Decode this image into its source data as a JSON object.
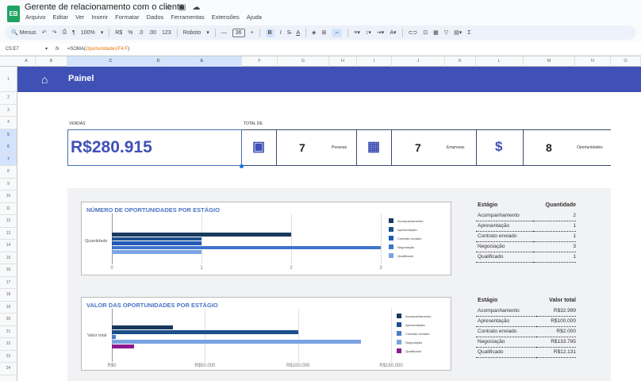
{
  "app": {
    "title": "Gerente de relacionamento com o cliente",
    "logo": "EB",
    "menu": [
      "Arquivo",
      "Editar",
      "Ver",
      "Inserir",
      "Formatar",
      "Dados",
      "Ferramentas",
      "Extensões",
      "Ajuda"
    ]
  },
  "toolbar": {
    "search": "Menus",
    "zoom": "100%",
    "currency": "R$",
    "percent": "%",
    "dec_less": ".0",
    "dec_more": ".00",
    "format": "123",
    "font": "Roboto",
    "font_size": "36",
    "bold": "B",
    "italic": "I",
    "sigma": "Σ"
  },
  "formula": {
    "cell_ref": "C5:E7",
    "fx": "fx",
    "formula_prefix": "=SOMA(",
    "formula_ref": "Oportunidades!F4:F",
    "formula_suffix": ")"
  },
  "columns": [
    "A",
    "B",
    "C",
    "D",
    "E",
    "F",
    "G",
    "H",
    "I",
    "J",
    "K",
    "L",
    "M",
    "N",
    "O"
  ],
  "rows": [
    "1",
    "2",
    "3",
    "4",
    "5",
    "6",
    "7",
    "8",
    "9",
    "10",
    "11",
    "12",
    "13",
    "14",
    "15",
    "16",
    "17",
    "18",
    "19",
    "20",
    "21",
    "22",
    "23",
    "24"
  ],
  "header": {
    "title": "Painel"
  },
  "kpi": {
    "sales_label": "VENDAS",
    "total_label": "TOTAL DE",
    "sales_value": "R$280.915",
    "items": [
      {
        "value": "7",
        "label": "Pessoas",
        "icon": "contact-icon"
      },
      {
        "value": "7",
        "label": "Empresas",
        "icon": "building-icon"
      },
      {
        "value": "8",
        "label": "Oportunidades",
        "icon": "dollar-icon"
      }
    ]
  },
  "chart_data": [
    {
      "type": "bar",
      "title": "NÚMERO DE OPORTUNIDADES POR ESTÁGIO",
      "ylabel": "Quantidade",
      "xlim": [
        0,
        3
      ],
      "xticks": [
        "0",
        "1",
        "2",
        "3"
      ],
      "series": [
        {
          "name": "Acompanhamento",
          "value": 2,
          "color": "#1a3a5e"
        },
        {
          "name": "Apresentação",
          "value": 1,
          "color": "#1d4f8e"
        },
        {
          "name": "Contrato enviado",
          "value": 1,
          "color": "#2459b8"
        },
        {
          "name": "Negociação",
          "value": 3,
          "color": "#3d74cc"
        },
        {
          "name": "Qualificado",
          "value": 1,
          "color": "#7ca4e2"
        }
      ]
    },
    {
      "type": "bar",
      "title": "VALOR DAS OPORTUNIDADES POR ESTÁGIO",
      "ylabel": "Valor total",
      "xlim": [
        0,
        150000
      ],
      "xticks": [
        "R$0",
        "R$50.000",
        "R$100.000",
        "R$150.000"
      ],
      "series": [
        {
          "name": "Acompanhamento",
          "value": 32999,
          "color": "#17375e"
        },
        {
          "name": "Apresentação",
          "value": 100000,
          "color": "#1c4f8a"
        },
        {
          "name": "Contrato enviado",
          "value": 2000,
          "color": "#4a7cc9"
        },
        {
          "name": "Negociação",
          "value": 133785,
          "color": "#7aa2e0"
        },
        {
          "name": "Qualificado",
          "value": 12131,
          "color": "#8e1a8e"
        }
      ]
    }
  ],
  "table1": {
    "headers": [
      "Estágio",
      "Quantidade"
    ],
    "rows": [
      [
        "Acompanhamento",
        "2"
      ],
      [
        "Apresentação",
        "1"
      ],
      [
        "Contrato enviado",
        "1"
      ],
      [
        "Negociação",
        "3"
      ],
      [
        "Qualificado",
        "1"
      ]
    ]
  },
  "table2": {
    "headers": [
      "Estágio",
      "Valor total"
    ],
    "rows": [
      [
        "Acompanhamento",
        "R$32.999"
      ],
      [
        "Apresentação",
        "R$100.000"
      ],
      [
        "Contrato enviado",
        "R$2.000"
      ],
      [
        "Negociação",
        "R$133.785"
      ],
      [
        "Qualificado",
        "R$12.131"
      ]
    ]
  }
}
